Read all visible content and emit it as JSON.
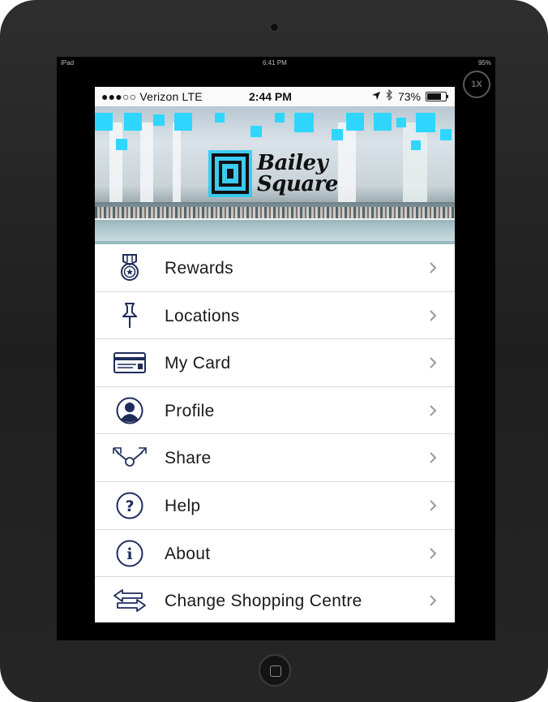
{
  "ipad": {
    "status_left": "iPad",
    "status_time": "6:41 PM",
    "status_battery": "95%",
    "zoom_label": "1X"
  },
  "phone": {
    "status": {
      "carrier": "●●●○○ Verizon  LTE",
      "time": "2:44 PM",
      "battery": "73%"
    },
    "banner": {
      "logo_line1": "Bailey",
      "logo_line2": "Square",
      "accent_color": "#22c9f4"
    },
    "menu": {
      "items": [
        {
          "label": "Rewards",
          "icon": "medal-icon"
        },
        {
          "label": "Locations",
          "icon": "pushpin-icon"
        },
        {
          "label": "My Card",
          "icon": "card-icon"
        },
        {
          "label": "Profile",
          "icon": "user-icon"
        },
        {
          "label": "Share",
          "icon": "share-icon"
        },
        {
          "label": "Help",
          "icon": "question-icon"
        },
        {
          "label": "About",
          "icon": "info-icon"
        },
        {
          "label": "Change Shopping Centre",
          "icon": "swap-arrows-icon"
        }
      ]
    },
    "icon_color": "#1f2d5c"
  }
}
